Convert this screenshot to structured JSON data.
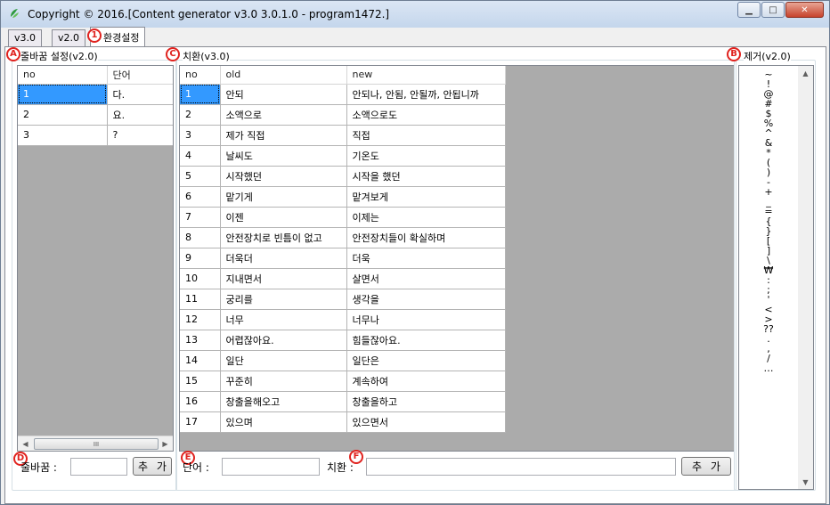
{
  "window": {
    "title": "Copyright © 2016.[Content generator v3.0 3.0.1.0 - program1472.]",
    "controls": {
      "minimize": "▁",
      "maximize": "□",
      "close": "✕"
    },
    "colors": {
      "selection": "#3399ff",
      "grid_background": "#ababab",
      "marker": "#e0231f"
    }
  },
  "tabs": [
    {
      "label": "v3.0"
    },
    {
      "label": "v2.0"
    },
    {
      "label": "환경설정"
    }
  ],
  "markers": {
    "tab": "1",
    "a": "A",
    "b": "B",
    "c": "C",
    "d": "D",
    "e": "E",
    "f": "F"
  },
  "linebreak": {
    "title": "줄바꿈 설정(v2.0)",
    "columns": [
      "no",
      "단어"
    ],
    "rows": [
      {
        "no": "1",
        "word": "다."
      },
      {
        "no": "2",
        "word": "요."
      },
      {
        "no": "3",
        "word": "?"
      }
    ],
    "scroll_thumb": "III",
    "input_label": "줄바꿈 :",
    "input_value": "",
    "add_button": "추 가"
  },
  "replace": {
    "title": "치환(v3.0)",
    "columns": [
      "no",
      "old",
      "new"
    ],
    "rows": [
      {
        "no": "1",
        "old": "안되",
        "new": "안되나, 안됨, 안될까, 안됩니까"
      },
      {
        "no": "2",
        "old": "소액으로",
        "new": "소액으로도"
      },
      {
        "no": "3",
        "old": "제가 직접",
        "new": "직접"
      },
      {
        "no": "4",
        "old": "날씨도",
        "new": "기온도"
      },
      {
        "no": "5",
        "old": "시작했던",
        "new": "시작을 했던"
      },
      {
        "no": "6",
        "old": "맡기게",
        "new": "맡겨보게"
      },
      {
        "no": "7",
        "old": "이젠",
        "new": "이제는"
      },
      {
        "no": "8",
        "old": "안전장치로 빈틈이 없고",
        "new": "안전장치들이 확실하며"
      },
      {
        "no": "9",
        "old": "더욱더",
        "new": "더욱"
      },
      {
        "no": "10",
        "old": "지내면서",
        "new": "살면서"
      },
      {
        "no": "11",
        "old": "궁리를",
        "new": "생각을"
      },
      {
        "no": "12",
        "old": "너무",
        "new": "너무나"
      },
      {
        "no": "13",
        "old": "어렵잖아요.",
        "new": "힘들잖아요."
      },
      {
        "no": "14",
        "old": "일단",
        "new": "일단은"
      },
      {
        "no": "15",
        "old": "꾸준히",
        "new": "계속하여"
      },
      {
        "no": "16",
        "old": "창출을해오고",
        "new": "창출을하고"
      },
      {
        "no": "17",
        "old": "있으며",
        "new": "있으면서"
      }
    ],
    "word_label": "단어 :",
    "word_value": "",
    "replace_label": "치환 :",
    "replace_value": "",
    "add_button": "추 가"
  },
  "remove": {
    "title": "제거(v2.0)",
    "items": [
      "~",
      "!",
      "@",
      "#",
      "$",
      "%",
      "^",
      "&",
      "*",
      "(",
      ")",
      "-",
      "+",
      "_",
      "=",
      "{",
      "}",
      "[",
      "]",
      "\\",
      "₩",
      ":",
      ";",
      "'",
      "<",
      ">",
      "??",
      ".",
      ",",
      "/",
      "…"
    ]
  }
}
